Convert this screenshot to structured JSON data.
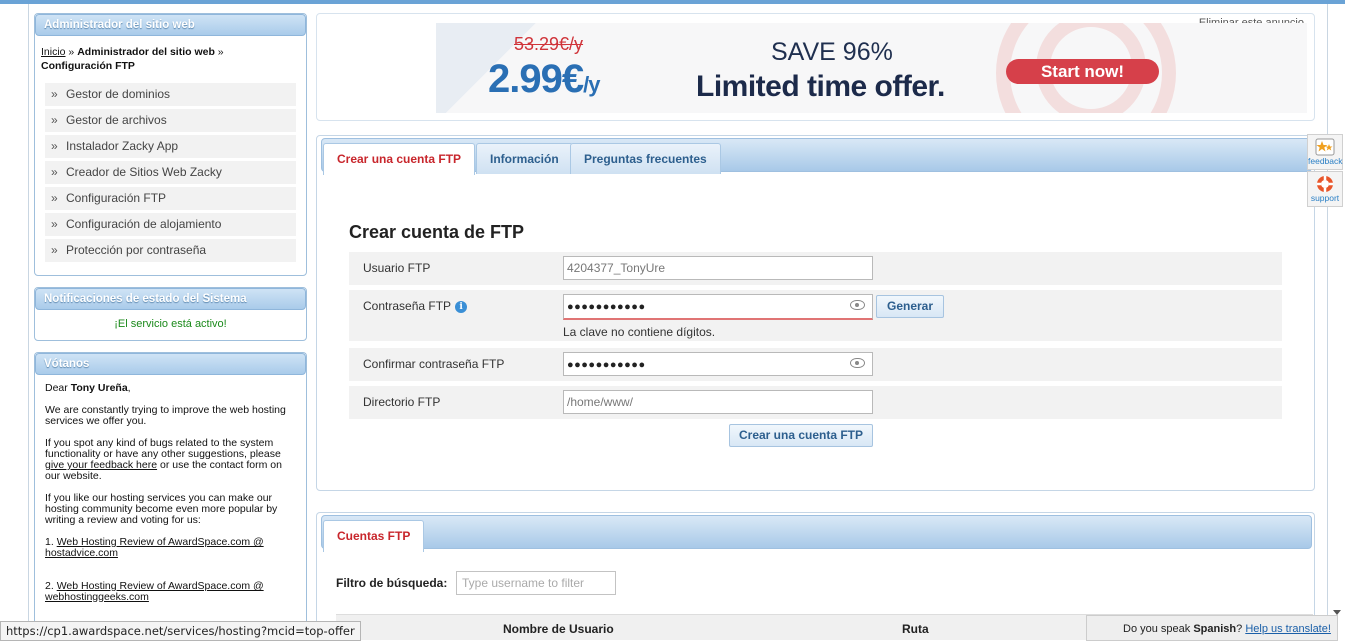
{
  "sidebar": {
    "admin_title": "Administrador del sitio web",
    "breadcrumb": {
      "home": "Inicio",
      "sep1": " » ",
      "section": "Administrador del sitio web",
      "sep2": " » ",
      "current": "Configuración FTP"
    },
    "menu": [
      "Gestor de dominios",
      "Gestor de archivos",
      "Instalador Zacky App",
      "Creador de Sitios Web Zacky",
      "Configuración FTP",
      "Configuración de alojamiento",
      "Protección por contraseña"
    ],
    "menu_bullet": "»",
    "status_title": "Notificaciones de estado del Sistema",
    "status_text": "¡El servicio está activo!",
    "vote_title": "Vótanos",
    "vote": {
      "greeting_pre": "Dear ",
      "user_name": "Tony Ureña",
      "greeting_post": ",",
      "p1": "We are constantly trying to improve the web hosting services we offer you.",
      "p2_pre": "If you spot any kind of bugs related to the system functionality or have any other suggestions, please ",
      "p2_link": "give your feedback here",
      "p2_post": " or use the contact form on our website.",
      "p3": "If you like our hosting services you can make our hosting community become even more popular by writing a review and voting for us:",
      "item1_num": "1. ",
      "item1_link": "Web Hosting Review of AwardSpace.com @ hostadvice.com",
      "item2_num": "2. ",
      "item2_link": "Web Hosting Review of AwardSpace.com @ webhostinggeeks.com"
    }
  },
  "ad": {
    "close_label": "Eliminar este anuncio",
    "old_price": "53.29€/y",
    "new_price": "2.99€",
    "per": "/y",
    "save": "SAVE 96%",
    "headline": "Limited time offer.",
    "cta": "Start now!"
  },
  "ftp_panel": {
    "tabs": [
      "Crear una cuenta FTP",
      "Información",
      "Preguntas frecuentes"
    ],
    "title": "Crear cuenta de FTP",
    "user_label": "Usuario FTP",
    "user_value": "4204377_TonyUre",
    "password_label": "Contraseña FTP",
    "info_glyph": "i",
    "password_value": "●●●●●●●●●●●",
    "generate_label": "Generar",
    "password_error": "La clave no contiene dígitos.",
    "confirm_label": "Confirmar contraseña FTP",
    "confirm_value": "●●●●●●●●●●●",
    "dir_label": "Directorio FTP",
    "dir_value": "/home/www/",
    "submit_label": "Crear una cuenta FTP"
  },
  "accounts_panel": {
    "tab": "Cuentas FTP",
    "filter_label": "Filtro de búsqueda:",
    "filter_placeholder": "Type username to filter",
    "columns": [
      "Nombre de Usuario",
      "Ruta"
    ]
  },
  "side_widgets": {
    "feedback_label": "feedback",
    "support_label": "support",
    "feedback_icon": "star-icon",
    "support_icon": "lifebuoy-icon"
  },
  "status_bar": {
    "url": "https://cp1.awardspace.net/services/hosting?mcid=top-offer"
  },
  "translate_bar": {
    "pre": "Do you speak ",
    "language": "Spanish",
    "mid": "? ",
    "link": "Help us translate!"
  },
  "colors": {
    "accent": "#2d5f8e",
    "active_tab": "#c8262c",
    "header_blue": "#a9cbea",
    "status_ok": "#1b8a1b",
    "cta_red": "#d6404a"
  }
}
